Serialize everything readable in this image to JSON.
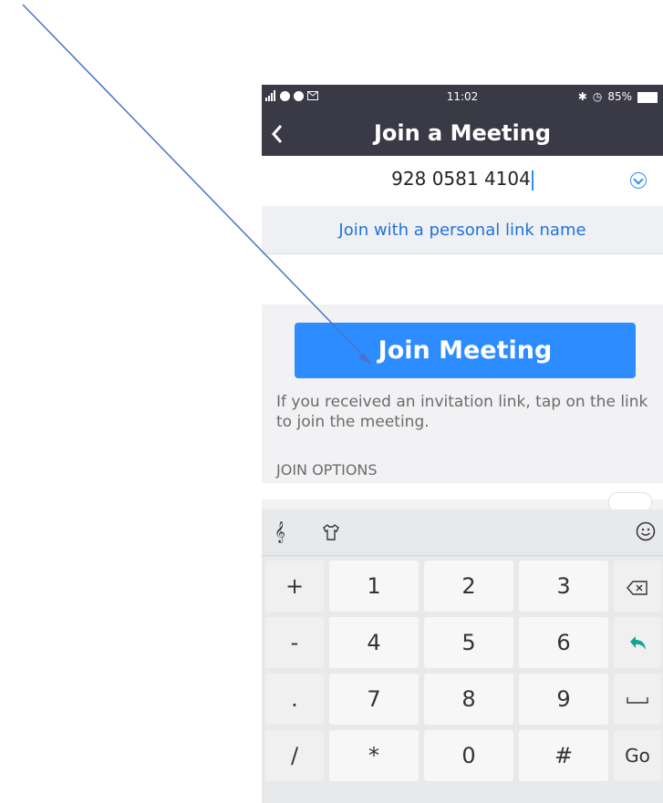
{
  "status_bar": {
    "time": "11:02",
    "battery": "85%",
    "bt_icon": "bluetooth-icon",
    "alarm_icon": "alarm-icon"
  },
  "header": {
    "title": "Join a Meeting",
    "back_icon": "chevron-left-icon"
  },
  "meeting_id": {
    "value": "928 0581 4104",
    "dropdown_icon": "chevron-down-icon"
  },
  "personal_link": {
    "label": "Join with a personal link name"
  },
  "join_button": {
    "label": "Join Meeting",
    "color": "#2d8cff"
  },
  "hint": {
    "text": "If you received an invitation link, tap on the link to join the meeting."
  },
  "join_options": {
    "label": "JOIN OPTIONS"
  },
  "keyboard": {
    "toolbar": {
      "left_icon": "voice-icon",
      "theme_icon": "shirt-icon",
      "emoji_icon": "emoji-icon"
    },
    "rows": [
      [
        "+",
        "1",
        "2",
        "3",
        "⌫"
      ],
      [
        "-",
        "4",
        "5",
        "6",
        "↵"
      ],
      [
        ".",
        "7",
        "8",
        "9",
        "␣"
      ],
      [
        "/",
        "*",
        "0",
        "#",
        "Go"
      ]
    ]
  },
  "annotation": {
    "color": "#4a73c8"
  }
}
